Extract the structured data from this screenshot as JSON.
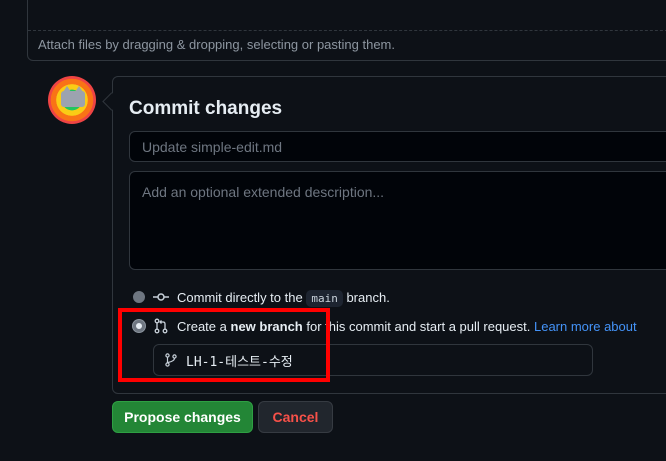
{
  "attach": {
    "hint": "Attach files by dragging & dropping, selecting or pasting them."
  },
  "commit": {
    "title": "Commit changes",
    "summary_placeholder": "Update simple-edit.md",
    "description_placeholder": "Add an optional extended description...",
    "option_direct": {
      "prefix": "Commit directly to the",
      "branch": "main",
      "suffix": "branch.",
      "selected": false,
      "icon": "git-commit-icon"
    },
    "option_new_branch": {
      "prefix": "Create a",
      "bold": "new branch",
      "suffix": "for this commit and start a pull request.",
      "link": "Learn more about",
      "selected": true,
      "icon": "git-pull-request-icon"
    },
    "branch_name": "LH-1-테스트-수정",
    "branch_icon": "git-branch-icon"
  },
  "actions": {
    "propose_label": "Propose changes",
    "cancel_label": "Cancel"
  },
  "colors": {
    "propose": "#238636",
    "cancel_text": "#f85149",
    "link": "#4493f8",
    "highlight": "#ff0000"
  }
}
